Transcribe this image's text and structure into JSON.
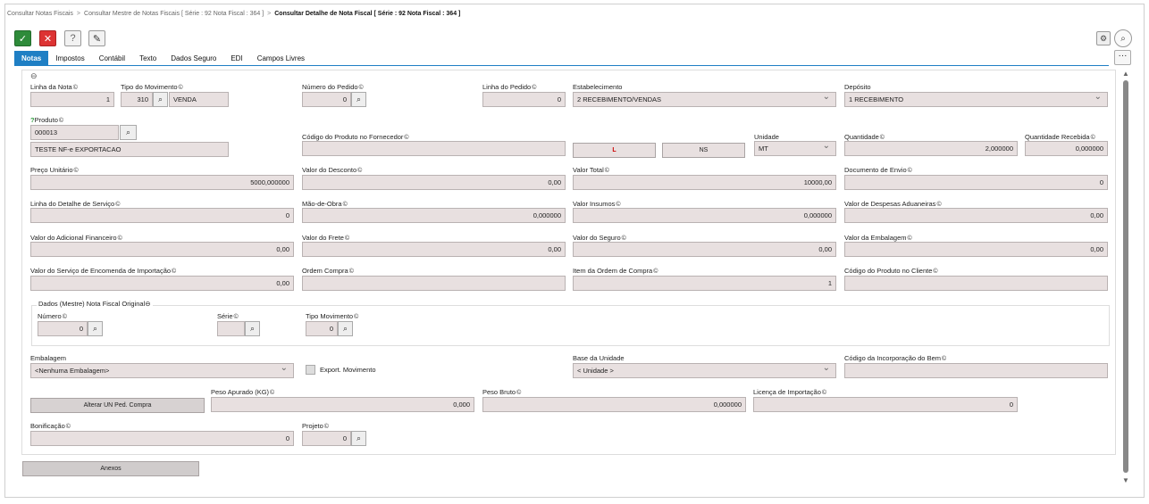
{
  "breadcrumb": {
    "item1": "Consultar Notas Fiscais",
    "item2": "Consultar Mestre de Notas Fiscais [ Série : 92 Nota Fiscal : 364 ]",
    "current": "Consultar Detalhe de Nota Fiscal [ Série : 92 Nota Fiscal : 364 ]",
    "separator": ">"
  },
  "toolbar": {
    "ok_icon": "✓",
    "cancel_icon": "✕",
    "help_icon": "?",
    "tool_icon": "✎",
    "settings_icon": "⚙",
    "search_icon": "⌕",
    "more_icon": "···"
  },
  "tabs": [
    "Notas",
    "Impostos",
    "Contábil",
    "Texto",
    "Dados Seguro",
    "EDI",
    "Campos Livres"
  ],
  "info_icon": "©",
  "fields": {
    "linha_nota": {
      "label": "Linha da Nota",
      "value": "1"
    },
    "tipo_mov": {
      "label": "Tipo do Movimento",
      "code": "310",
      "desc": "VENDA"
    },
    "num_pedido": {
      "label": "Número do Pedido",
      "value": "0"
    },
    "linha_pedido": {
      "label": "Linha do Pedido",
      "value": "0"
    },
    "estabelecimento": {
      "label": "Estabelecimento",
      "value": "2 RECEBIMENTO/VENDAS"
    },
    "deposito": {
      "label": "Depósito",
      "value": "1 RECEBIMENTO"
    },
    "produto": {
      "label": "Produto",
      "code": "000013",
      "desc": "TESTE NF-e  EXPORTACAO"
    },
    "cod_fornecedor": {
      "label": "Código do Produto no Fornecedor",
      "value": ""
    },
    "box_l": "L",
    "box_ns": "NS",
    "unidade": {
      "label": "Unidade",
      "value": "MT"
    },
    "quantidade": {
      "label": "Quantidade",
      "value": "2,000000"
    },
    "qtd_recebida": {
      "label": "Quantidade Recebida",
      "value": "0,000000"
    },
    "preco_unit": {
      "label": "Preço Unitário",
      "value": "5000,000000"
    },
    "valor_desconto": {
      "label": "Valor do Desconto",
      "value": "0,00"
    },
    "valor_total": {
      "label": "Valor Total",
      "value": "10000,00"
    },
    "doc_envio": {
      "label": "Documento de Envio",
      "value": "0"
    },
    "linha_servico": {
      "label": "Linha do Detalhe de Serviço",
      "value": "0"
    },
    "mao_obra": {
      "label": "Mão-de-Obra",
      "value": "0,000000"
    },
    "valor_insumos": {
      "label": "Valor Insumos",
      "value": "0,000000"
    },
    "desp_aduaneiras": {
      "label": "Valor de Despesas Aduaneiras",
      "value": "0,00"
    },
    "adic_financeiro": {
      "label": "Valor do Adicional Financeiro",
      "value": "0,00"
    },
    "valor_frete": {
      "label": "Valor do Frete",
      "value": "0,00"
    },
    "valor_seguro": {
      "label": "Valor do Seguro",
      "value": "0,00"
    },
    "valor_embalagem": {
      "label": "Valor da Embalagem",
      "value": "0,00"
    },
    "serv_encomenda": {
      "label": "Valor do Serviço de Encomenda de Importação",
      "value": "0,00"
    },
    "ordem_compra": {
      "label": "Ordem Compra",
      "value": ""
    },
    "item_ordem": {
      "label": "Item da Ordem de Compra",
      "value": "1"
    },
    "cod_cliente": {
      "label": "Código do Produto no Cliente",
      "value": ""
    },
    "grupo_titulo": "Dados (Mestre) Nota Fiscal Original",
    "numero": {
      "label": "Número",
      "value": "0"
    },
    "serie": {
      "label": "Série",
      "value": ""
    },
    "tipo_mov2": {
      "label": "Tipo Movimento",
      "value": "0"
    },
    "embalagem": {
      "label": "Embalagem",
      "value": "<Nenhuma Embalagem>"
    },
    "export_mov": "Export. Movimento",
    "base_unidade": {
      "label": "Base da Unidade",
      "value": "< Unidade >"
    },
    "cod_incorp": {
      "label": "Código da Incorporação do Bem",
      "value": ""
    },
    "alterar_btn": "Alterar UN Ped. Compra",
    "peso_apurado": {
      "label": "Peso Apurado (KG)",
      "value": "0,000"
    },
    "peso_bruto": {
      "label": "Peso Bruto",
      "value": "0,000000"
    },
    "licenca": {
      "label": "Licença de Importação",
      "value": "0"
    },
    "bonificacao": {
      "label": "Bonificação",
      "value": "0"
    },
    "projeto": {
      "label": "Projeto",
      "value": "0"
    },
    "anexos_btn": "Anexos"
  }
}
